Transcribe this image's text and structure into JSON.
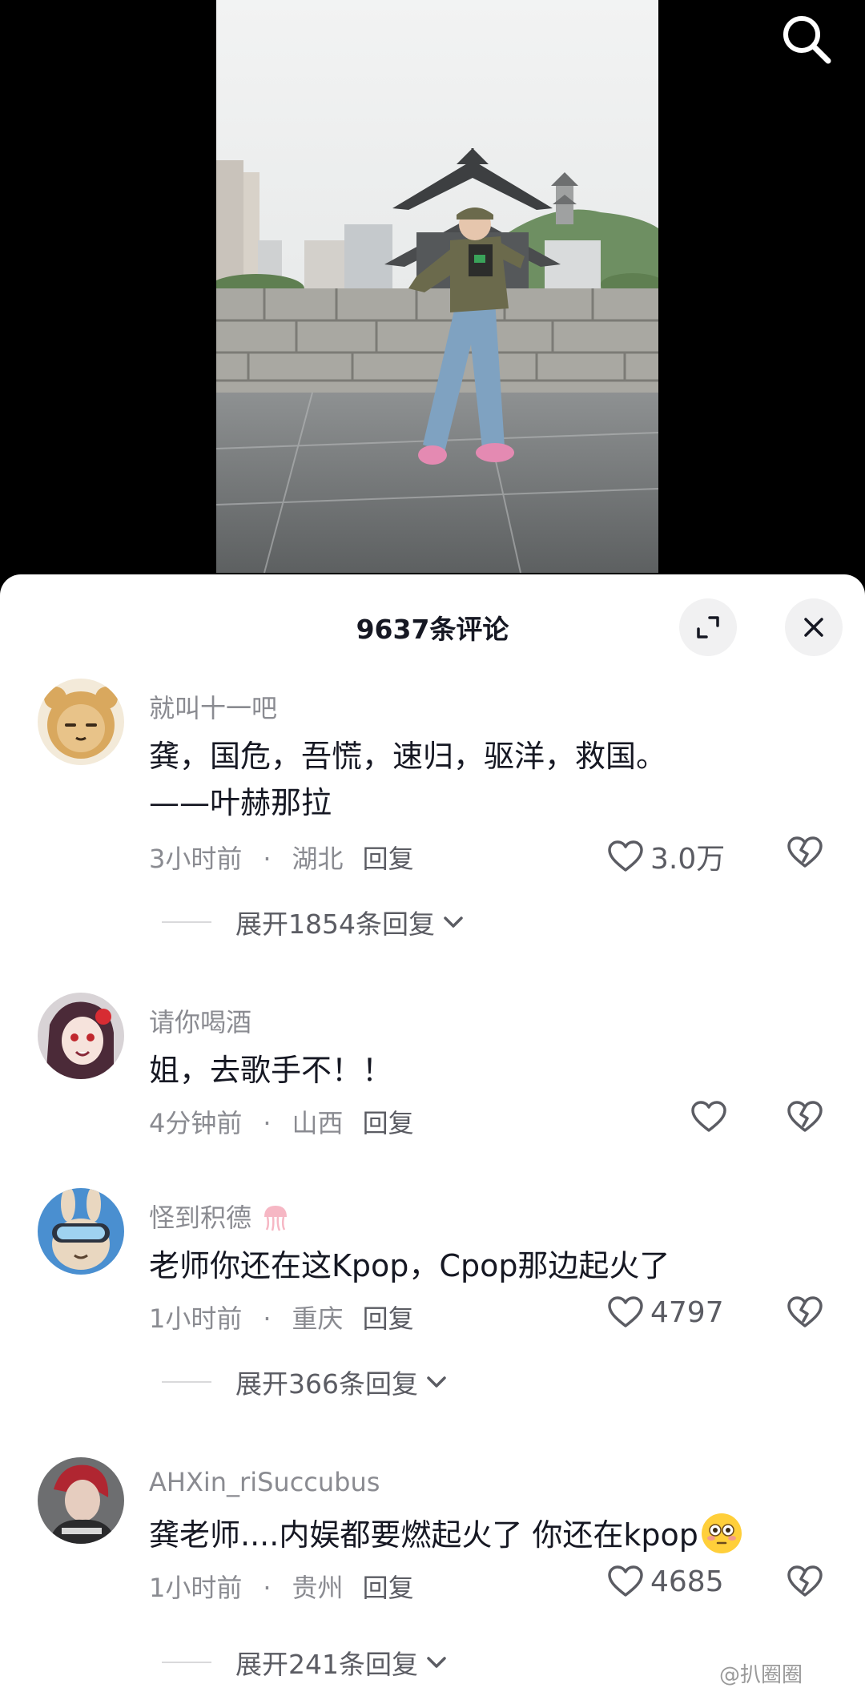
{
  "header": {
    "comment_count": "9637条评论"
  },
  "colors": {
    "sheet_bg": "#ffffff",
    "muted_text": "#8a8b91",
    "primary_text": "#161823"
  },
  "icons": {
    "search": "search-icon",
    "expand": "expand-icon",
    "close": "close-icon",
    "like": "heart-outline-icon",
    "dislike": "broken-heart-icon",
    "chevron": "chevron-down-icon"
  },
  "comments": [
    {
      "username": "就叫十一吧",
      "text": "龚，国危，吾慌，速归，驱洋，救国。　　——叶赫那拉",
      "time": "3小时前",
      "location": "湖北",
      "reply_label": "回复",
      "likes": "3.0万",
      "expand_label": "展开1854条回复"
    },
    {
      "username": "请你喝酒",
      "text": "姐，去歌手不！！",
      "time": "4分钟前",
      "location": "山西",
      "reply_label": "回复",
      "likes": ""
    },
    {
      "username": "怪到积德",
      "text": "老师你还在这Kpop，Cpop那边起火了",
      "time": "1小时前",
      "location": "重庆",
      "reply_label": "回复",
      "likes": "4797",
      "expand_label": "展开366条回复"
    },
    {
      "username": "AHXin_riSuccubus",
      "text": "龚老师....内娱都要燃起火了 你还在kpop",
      "time": "1小时前",
      "location": "贵州",
      "reply_label": "回复",
      "likes": "4685",
      "expand_label": "展开241条回复"
    }
  ],
  "watermark": "@扒圈圈"
}
